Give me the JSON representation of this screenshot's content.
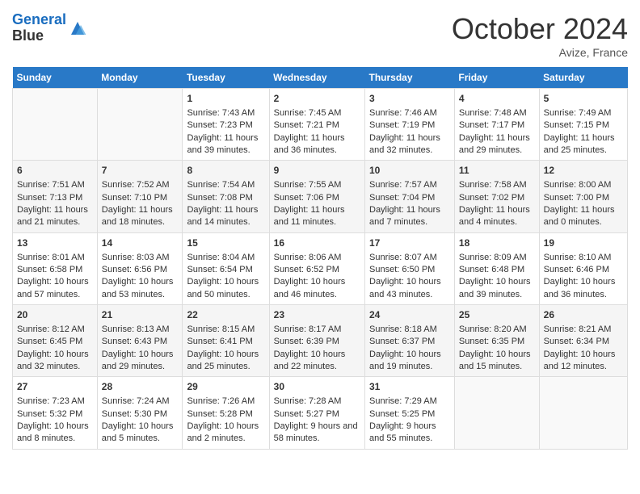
{
  "logo": {
    "line1": "General",
    "line2": "Blue"
  },
  "title": "October 2024",
  "location": "Avize, France",
  "days_header": [
    "Sunday",
    "Monday",
    "Tuesday",
    "Wednesday",
    "Thursday",
    "Friday",
    "Saturday"
  ],
  "weeks": [
    [
      {
        "day": "",
        "content": ""
      },
      {
        "day": "",
        "content": ""
      },
      {
        "day": "1",
        "content": "Sunrise: 7:43 AM\nSunset: 7:23 PM\nDaylight: 11 hours and 39 minutes."
      },
      {
        "day": "2",
        "content": "Sunrise: 7:45 AM\nSunset: 7:21 PM\nDaylight: 11 hours and 36 minutes."
      },
      {
        "day": "3",
        "content": "Sunrise: 7:46 AM\nSunset: 7:19 PM\nDaylight: 11 hours and 32 minutes."
      },
      {
        "day": "4",
        "content": "Sunrise: 7:48 AM\nSunset: 7:17 PM\nDaylight: 11 hours and 29 minutes."
      },
      {
        "day": "5",
        "content": "Sunrise: 7:49 AM\nSunset: 7:15 PM\nDaylight: 11 hours and 25 minutes."
      }
    ],
    [
      {
        "day": "6",
        "content": "Sunrise: 7:51 AM\nSunset: 7:13 PM\nDaylight: 11 hours and 21 minutes."
      },
      {
        "day": "7",
        "content": "Sunrise: 7:52 AM\nSunset: 7:10 PM\nDaylight: 11 hours and 18 minutes."
      },
      {
        "day": "8",
        "content": "Sunrise: 7:54 AM\nSunset: 7:08 PM\nDaylight: 11 hours and 14 minutes."
      },
      {
        "day": "9",
        "content": "Sunrise: 7:55 AM\nSunset: 7:06 PM\nDaylight: 11 hours and 11 minutes."
      },
      {
        "day": "10",
        "content": "Sunrise: 7:57 AM\nSunset: 7:04 PM\nDaylight: 11 hours and 7 minutes."
      },
      {
        "day": "11",
        "content": "Sunrise: 7:58 AM\nSunset: 7:02 PM\nDaylight: 11 hours and 4 minutes."
      },
      {
        "day": "12",
        "content": "Sunrise: 8:00 AM\nSunset: 7:00 PM\nDaylight: 11 hours and 0 minutes."
      }
    ],
    [
      {
        "day": "13",
        "content": "Sunrise: 8:01 AM\nSunset: 6:58 PM\nDaylight: 10 hours and 57 minutes."
      },
      {
        "day": "14",
        "content": "Sunrise: 8:03 AM\nSunset: 6:56 PM\nDaylight: 10 hours and 53 minutes."
      },
      {
        "day": "15",
        "content": "Sunrise: 8:04 AM\nSunset: 6:54 PM\nDaylight: 10 hours and 50 minutes."
      },
      {
        "day": "16",
        "content": "Sunrise: 8:06 AM\nSunset: 6:52 PM\nDaylight: 10 hours and 46 minutes."
      },
      {
        "day": "17",
        "content": "Sunrise: 8:07 AM\nSunset: 6:50 PM\nDaylight: 10 hours and 43 minutes."
      },
      {
        "day": "18",
        "content": "Sunrise: 8:09 AM\nSunset: 6:48 PM\nDaylight: 10 hours and 39 minutes."
      },
      {
        "day": "19",
        "content": "Sunrise: 8:10 AM\nSunset: 6:46 PM\nDaylight: 10 hours and 36 minutes."
      }
    ],
    [
      {
        "day": "20",
        "content": "Sunrise: 8:12 AM\nSunset: 6:45 PM\nDaylight: 10 hours and 32 minutes."
      },
      {
        "day": "21",
        "content": "Sunrise: 8:13 AM\nSunset: 6:43 PM\nDaylight: 10 hours and 29 minutes."
      },
      {
        "day": "22",
        "content": "Sunrise: 8:15 AM\nSunset: 6:41 PM\nDaylight: 10 hours and 25 minutes."
      },
      {
        "day": "23",
        "content": "Sunrise: 8:17 AM\nSunset: 6:39 PM\nDaylight: 10 hours and 22 minutes."
      },
      {
        "day": "24",
        "content": "Sunrise: 8:18 AM\nSunset: 6:37 PM\nDaylight: 10 hours and 19 minutes."
      },
      {
        "day": "25",
        "content": "Sunrise: 8:20 AM\nSunset: 6:35 PM\nDaylight: 10 hours and 15 minutes."
      },
      {
        "day": "26",
        "content": "Sunrise: 8:21 AM\nSunset: 6:34 PM\nDaylight: 10 hours and 12 minutes."
      }
    ],
    [
      {
        "day": "27",
        "content": "Sunrise: 7:23 AM\nSunset: 5:32 PM\nDaylight: 10 hours and 8 minutes."
      },
      {
        "day": "28",
        "content": "Sunrise: 7:24 AM\nSunset: 5:30 PM\nDaylight: 10 hours and 5 minutes."
      },
      {
        "day": "29",
        "content": "Sunrise: 7:26 AM\nSunset: 5:28 PM\nDaylight: 10 hours and 2 minutes."
      },
      {
        "day": "30",
        "content": "Sunrise: 7:28 AM\nSunset: 5:27 PM\nDaylight: 9 hours and 58 minutes."
      },
      {
        "day": "31",
        "content": "Sunrise: 7:29 AM\nSunset: 5:25 PM\nDaylight: 9 hours and 55 minutes."
      },
      {
        "day": "",
        "content": ""
      },
      {
        "day": "",
        "content": ""
      }
    ]
  ]
}
